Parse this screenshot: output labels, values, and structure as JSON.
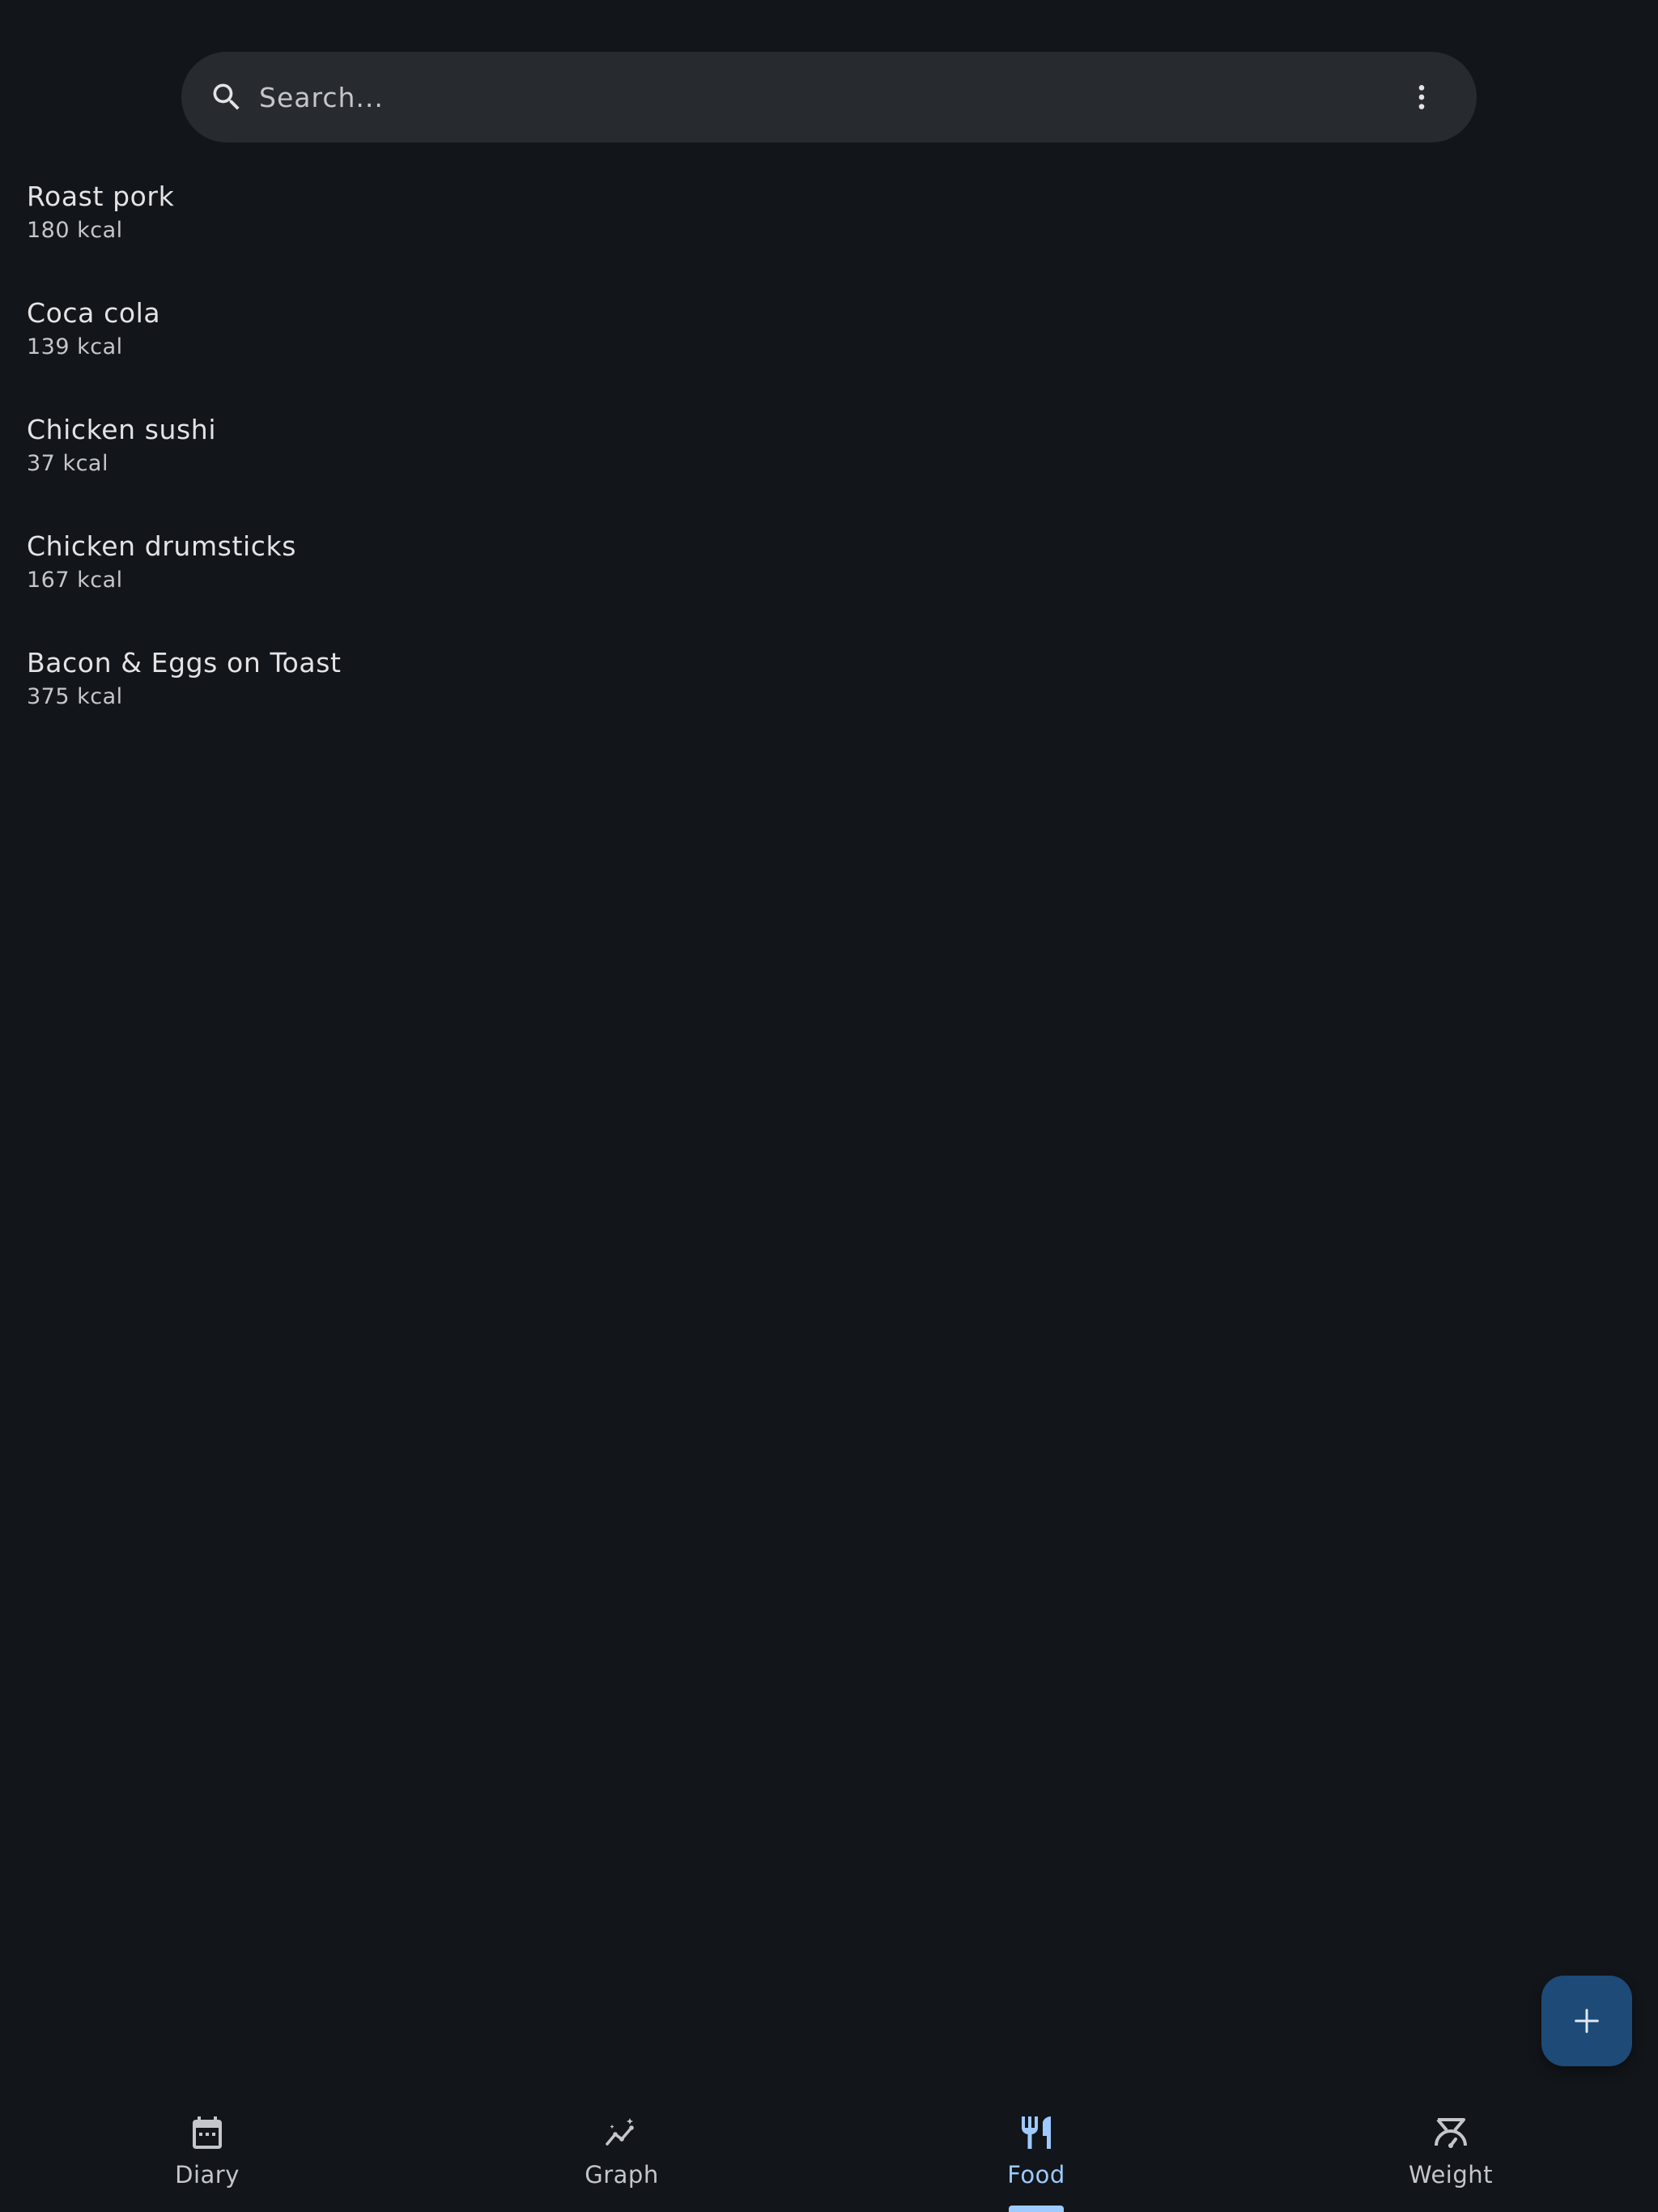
{
  "search": {
    "placeholder": "Search..."
  },
  "foods": [
    {
      "name": "Roast pork",
      "kcal": "180 kcal"
    },
    {
      "name": "Coca cola",
      "kcal": "139 kcal"
    },
    {
      "name": "Chicken sushi",
      "kcal": "37 kcal"
    },
    {
      "name": "Chicken drumsticks",
      "kcal": "167 kcal"
    },
    {
      "name": "Bacon & Eggs on Toast",
      "kcal": "375 kcal"
    }
  ],
  "nav": {
    "items": [
      {
        "label": "Diary",
        "icon": "calendar-icon"
      },
      {
        "label": "Graph",
        "icon": "graph-icon"
      },
      {
        "label": "Food",
        "icon": "food-icon",
        "active": true
      },
      {
        "label": "Weight",
        "icon": "scale-icon"
      }
    ]
  },
  "colors": {
    "background": "#121519",
    "search_bar": "#272a2f",
    "accent": "#9ecaff",
    "fab": "#1d4a77"
  }
}
